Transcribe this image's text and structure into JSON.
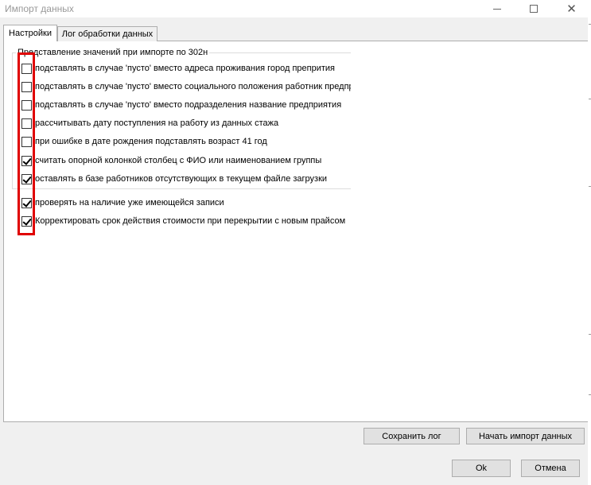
{
  "window": {
    "title": "Импорт данных"
  },
  "tabs": [
    {
      "label": "Настройки",
      "active": true
    },
    {
      "label": "Лог обработки данных",
      "active": false
    }
  ],
  "group": {
    "title": "Представление значений при импорте по 302н",
    "options": [
      {
        "label": "подставлять в случае 'пусто' вместо адреса проживания город препрития",
        "checked": false
      },
      {
        "label": "подставлять в случае 'пусто' вместо социального положения работник предприятия",
        "checked": false
      },
      {
        "label": "подставлять в случае 'пусто' вместо подразделения название предприятия",
        "checked": false
      },
      {
        "label": "рассчитывать дату поступления на работу из данных стажа",
        "checked": false
      },
      {
        "label": "при ошибке в дате рождения подставлять возраст 41 год",
        "checked": false
      },
      {
        "label": "считать опорной колонкой столбец с ФИО или наименованием группы",
        "checked": true
      },
      {
        "label": "оставлять в базе работников отсутствующих в текущем файле загрузки",
        "checked": true
      }
    ]
  },
  "extra_options": [
    {
      "label": "проверять на наличие уже имеющейся записи",
      "checked": true
    },
    {
      "label": "Корректировать срок действия стоимости при перекрытии с новым прайсом",
      "checked": true
    }
  ],
  "buttons": {
    "save_log": "Сохранить лог",
    "start_import": "Начать импорт данных",
    "ok": "Ok",
    "cancel": "Отмена"
  },
  "colors": {
    "highlight": "#e00000",
    "default_button_border": "#0078d7"
  }
}
